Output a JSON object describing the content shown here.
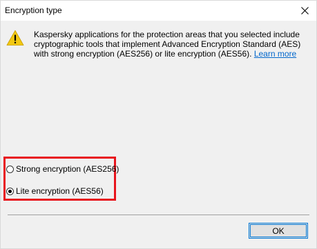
{
  "dialog": {
    "title": "Encryption type",
    "close_icon": "close-icon"
  },
  "message": {
    "icon": "warning-icon",
    "text": "Kaspersky applications for the protection areas that you selected include cryptographic tools that implement Advanced Encryption Standard (AES) with strong encryption (AES256) or lite encryption (AES56). ",
    "link_text": "Learn more"
  },
  "options": [
    {
      "label": "Strong encryption (AES256)",
      "selected": false
    },
    {
      "label": "Lite encryption (AES56)",
      "selected": true
    }
  ],
  "buttons": {
    "ok_label": "OK"
  },
  "colors": {
    "highlight_border": "#e8141c",
    "link": "#0066cc",
    "warning_fill": "#f2c811",
    "focus_border": "#0078d7"
  }
}
